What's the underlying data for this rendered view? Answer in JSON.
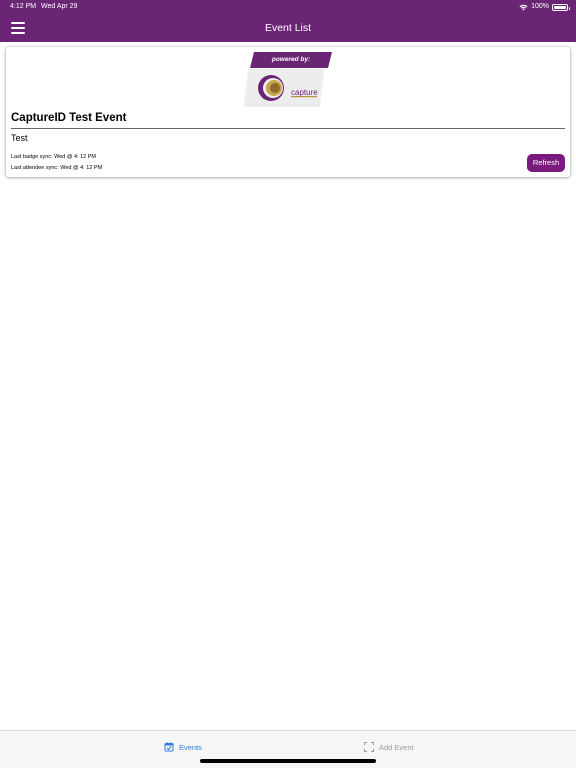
{
  "status_bar": {
    "time": "4:12 PM",
    "date": "Wed Apr 29",
    "battery": "100%"
  },
  "header": {
    "title": "Event List",
    "menu_icon": "hamburger-menu-icon"
  },
  "event": {
    "logo": {
      "tagline": "powered by:",
      "brand": "capture"
    },
    "name": "CaptureID Test Event",
    "subtitle": "Test",
    "last_badge_sync": "Last badge sync: Wed @ 4: 12 PM",
    "last_attendee_sync": "Last attendee sync: Wed @ 4: 12 PM",
    "refresh_label": "Refresh"
  },
  "tabs": [
    {
      "label": "Events",
      "icon": "calendar-check-icon",
      "active": true
    },
    {
      "label": "Add Event",
      "icon": "scan-frame-icon",
      "active": false
    }
  ],
  "colors": {
    "header_bg": "#6b2575",
    "accent": "#7b1a7e",
    "tab_active": "#2b7de0",
    "tab_inactive": "#9a9a9a"
  }
}
